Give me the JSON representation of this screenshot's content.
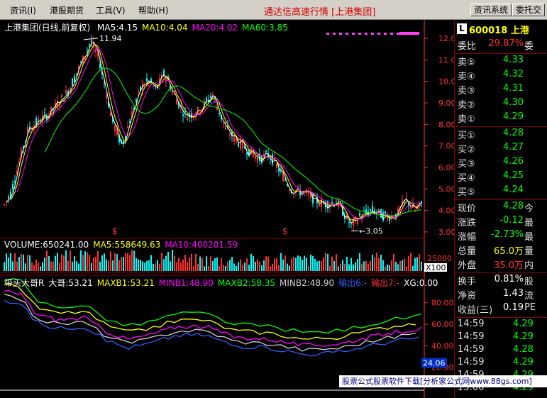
{
  "menu": {
    "items": [
      "资讯(I)",
      "港股期货",
      "工具(V)",
      "帮助(H)"
    ],
    "app_title": "通达信高速行情 [上港集团]",
    "buttons": [
      "资讯系统",
      "委托交"
    ]
  },
  "chart": {
    "title": "上港集团(日线,前复权)",
    "ma_labels": [
      {
        "text": "MA5:4.15",
        "color": "#ffffff"
      },
      {
        "text": "MA10:4.04",
        "color": "#ffff00"
      },
      {
        "text": "MA20:4.02",
        "color": "#ff00ff"
      },
      {
        "text": "MA60:3.85",
        "color": "#00ff00"
      }
    ],
    "price_axis": [
      "12.00",
      "11.00",
      "10.00",
      "9.00",
      "8.00",
      "7.00",
      "6.00",
      "5.00",
      "4.00",
      "3.00"
    ],
    "high_label": "11.94",
    "low_label": "3.05",
    "signal_marks": [
      "$",
      "$"
    ],
    "volume_labels": [
      {
        "text": "VOLUME:650241.00",
        "color": "#ffffff"
      },
      {
        "text": "MA5:558649.63",
        "color": "#ffff00"
      },
      {
        "text": "MA10:400201.59",
        "color": "#ff00ff"
      }
    ],
    "volume_axis": "25000",
    "volume_unit": "X100",
    "indicator_labels": [
      {
        "text": "带头大哥R",
        "color": "#ffffff"
      },
      {
        "text": "大哥:53.21",
        "color": "#ffffff"
      },
      {
        "text": "MAXB1:53.21",
        "color": "#ffff00"
      },
      {
        "text": "MINB1:48.90",
        "color": "#ff00ff"
      },
      {
        "text": "MAXB2:58.35",
        "color": "#00ff00"
      },
      {
        "text": "MINB2:48.90",
        "color": "#d0d0d0"
      },
      {
        "text": "输出6:-",
        "color": "#3060ff"
      },
      {
        "text": "输出7:-",
        "color": "#ff3030"
      },
      {
        "text": "XG:0.00",
        "color": "#ffffff"
      }
    ],
    "indicator_axis": [
      "80.00",
      "60.00",
      "40.00",
      "20.00"
    ],
    "indicator_current": "24.06",
    "colors": {
      "up": "#ff3030",
      "down": "#00ffff",
      "ma5": "#ffffff",
      "ma10": "#ffff00",
      "ma20": "#ff00ff",
      "ma60": "#00ff00",
      "axis": "#ff3030",
      "grid": "#800000"
    }
  },
  "quote": {
    "code": "600018",
    "name": "上港",
    "ratio": {
      "label": "委比",
      "value": "29.87%",
      "extra": "委"
    },
    "asks": [
      {
        "label": "卖⑤",
        "price": "4.33"
      },
      {
        "label": "卖④",
        "price": "4.32"
      },
      {
        "label": "卖③",
        "price": "4.31"
      },
      {
        "label": "卖②",
        "price": "4.30"
      },
      {
        "label": "卖①",
        "price": "4.29"
      }
    ],
    "bids": [
      {
        "label": "买①",
        "price": "4.28"
      },
      {
        "label": "买②",
        "price": "4.27"
      },
      {
        "label": "买③",
        "price": "4.26"
      },
      {
        "label": "买④",
        "price": "4.25"
      },
      {
        "label": "买⑤",
        "price": "4.24"
      }
    ],
    "stats": [
      {
        "label": "现价",
        "value": "4.28",
        "extra": "今",
        "color": "#00ff00"
      },
      {
        "label": "涨跌",
        "value": "-0.12",
        "extra": "最",
        "color": "#00ff00"
      },
      {
        "label": "涨幅",
        "value": "-2.73%",
        "extra": "最",
        "color": "#00ff00"
      },
      {
        "label": "总量",
        "value": "65.0万",
        "extra": "量",
        "color": "#ffff00"
      },
      {
        "label": "外盘",
        "value": "35.0万",
        "extra": "内",
        "color": "#ff3030"
      }
    ],
    "fin": [
      {
        "label": "换手",
        "value": "0.81%",
        "extra": "股"
      },
      {
        "label": "净资",
        "value": "1.43",
        "extra": "流"
      },
      {
        "label": "收益(三)",
        "value": "0.19",
        "extra": "PE"
      }
    ],
    "ticks": [
      {
        "time": "14:59",
        "price": "4.29"
      },
      {
        "time": "14:59",
        "price": "4.29"
      },
      {
        "time": "14:59",
        "price": "4.28"
      },
      {
        "time": "14:59",
        "price": "4.29"
      },
      {
        "time": "14:59",
        "price": "4.29"
      },
      {
        "time": "15:00",
        "price": "4.29"
      }
    ]
  },
  "ad_text": "股票公式股票软件下载[分析家公式网www.88gs.com]"
}
